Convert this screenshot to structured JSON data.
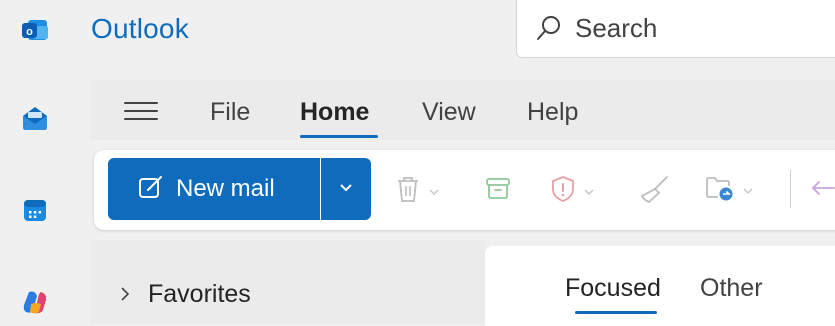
{
  "app": {
    "title": "Outlook"
  },
  "search": {
    "placeholder": "Search"
  },
  "rail": {
    "items": [
      "outlook-logo",
      "mail",
      "calendar",
      "copilot"
    ]
  },
  "menu": {
    "tabs": [
      "File",
      "Home",
      "View",
      "Help"
    ],
    "active": "Home"
  },
  "ribbon": {
    "new_mail_label": "New mail",
    "actions": [
      "delete",
      "archive",
      "report",
      "sweep",
      "move-to"
    ]
  },
  "nav": {
    "favorites_label": "Favorites"
  },
  "inbox": {
    "pivots": [
      "Focused",
      "Other"
    ],
    "active": "Focused"
  },
  "colors": {
    "accent": "#0f6cbd",
    "background": "#f0f0f0",
    "surface": "#ffffff"
  }
}
